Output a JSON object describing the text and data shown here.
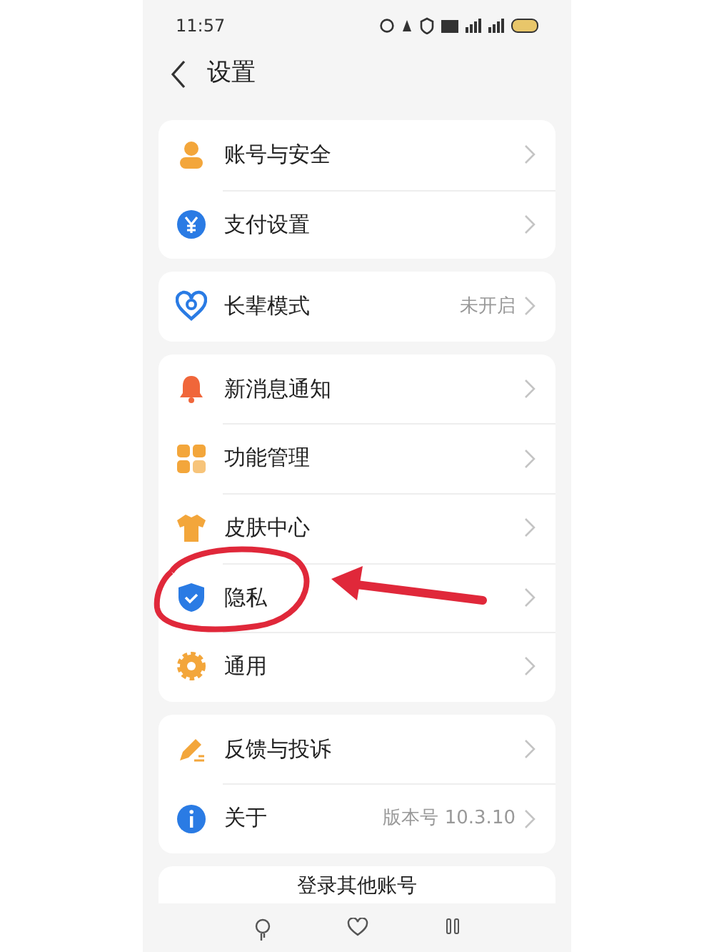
{
  "status_bar": {
    "time": "11:57"
  },
  "header": {
    "title": "设置"
  },
  "groups": [
    {
      "items": [
        {
          "label": "账号与安全"
        },
        {
          "label": "支付设置"
        }
      ]
    },
    {
      "items": [
        {
          "label": "长辈模式",
          "value": "未开启"
        }
      ]
    },
    {
      "items": [
        {
          "label": "新消息通知"
        },
        {
          "label": "功能管理"
        },
        {
          "label": "皮肤中心"
        },
        {
          "label": "隐私"
        },
        {
          "label": "通用"
        }
      ]
    },
    {
      "items": [
        {
          "label": "反馈与投诉"
        },
        {
          "label": "关于",
          "value": "版本号 10.3.10"
        }
      ]
    }
  ],
  "bottom_button": "登录其他账号"
}
